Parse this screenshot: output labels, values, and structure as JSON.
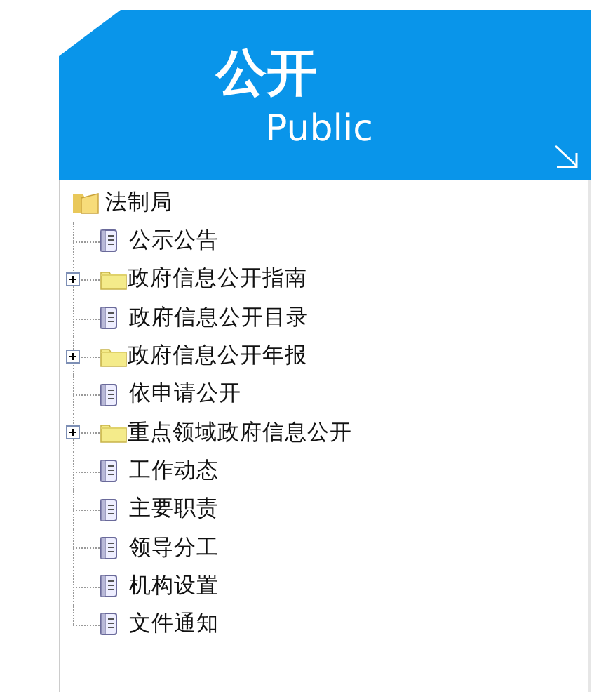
{
  "header": {
    "title": "公开",
    "subtitle": "Public"
  },
  "tree": {
    "label": "法制局",
    "expanded": true,
    "children": [
      {
        "kind": "leaf",
        "label": "公示公告"
      },
      {
        "kind": "folder",
        "label": "政府信息公开指南",
        "expanded": false
      },
      {
        "kind": "leaf",
        "label": "政府信息公开目录"
      },
      {
        "kind": "folder",
        "label": "政府信息公开年报",
        "expanded": false
      },
      {
        "kind": "leaf",
        "label": "依申请公开"
      },
      {
        "kind": "folder",
        "label": "重点领域政府信息公开",
        "expanded": false
      },
      {
        "kind": "leaf",
        "label": "工作动态"
      },
      {
        "kind": "leaf",
        "label": "主要职责"
      },
      {
        "kind": "leaf",
        "label": "领导分工"
      },
      {
        "kind": "leaf",
        "label": "机构设置"
      },
      {
        "kind": "leaf",
        "label": "文件通知"
      }
    ]
  }
}
